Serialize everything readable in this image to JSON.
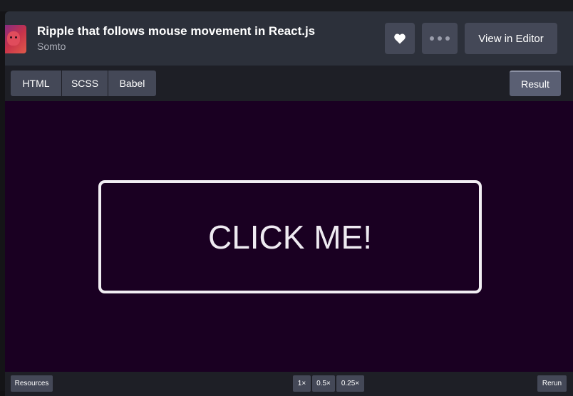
{
  "header": {
    "title": "Ripple that follows mouse movement in React.js",
    "author": "Somto",
    "editor_button": "View in Editor",
    "heart_icon": "heart-icon",
    "more_icon": "more-dots-icon"
  },
  "tabs": {
    "html": "HTML",
    "scss": "SCSS",
    "babel": "Babel",
    "result": "Result"
  },
  "result": {
    "button_label": "CLICK ME!",
    "background_color": "#1a0022",
    "button_border_color": "#f1eef3"
  },
  "bottom_bar": {
    "resources": "Resources",
    "zoom_options": [
      "1×",
      "0.5×",
      "0.25×"
    ],
    "rerun": "Rerun"
  }
}
